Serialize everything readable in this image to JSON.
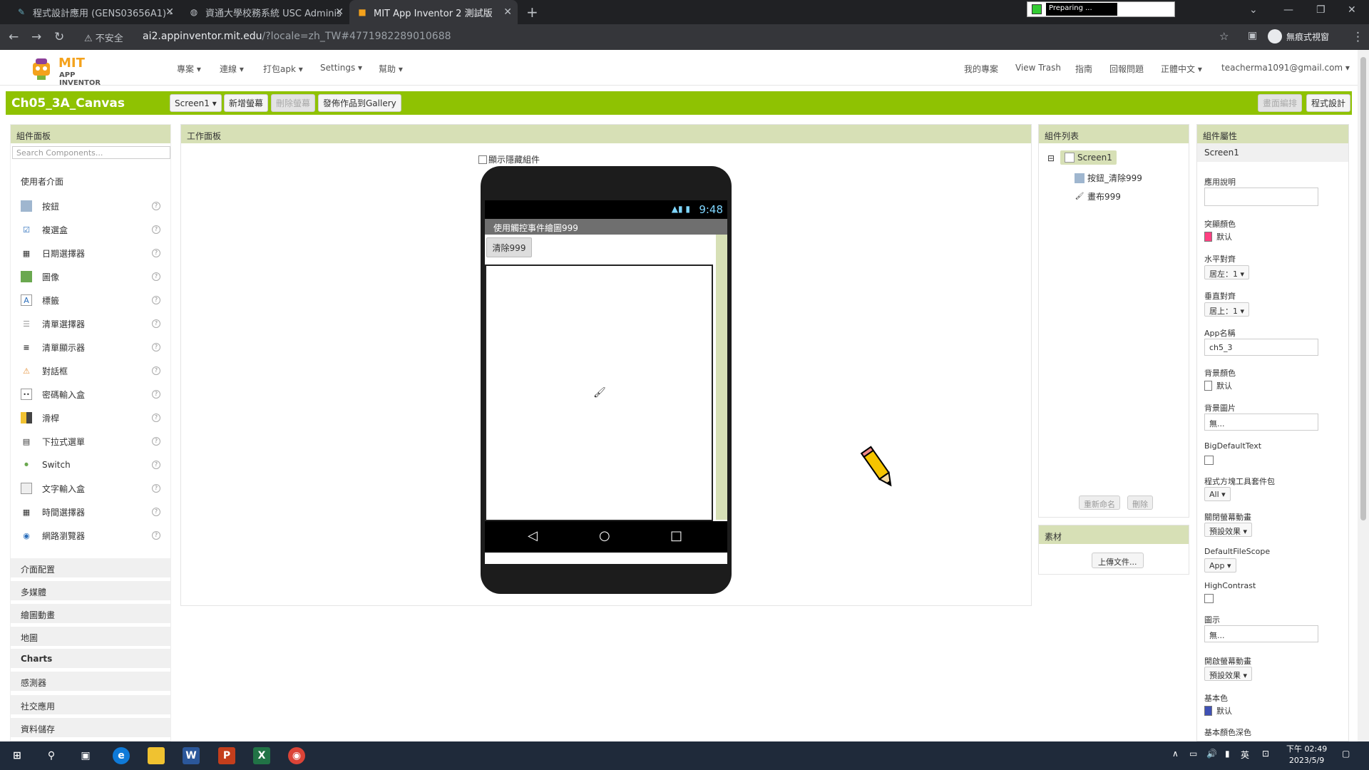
{
  "browser": {
    "tabs": [
      {
        "label": "程式設計應用 (GENS03656A1) -",
        "active": false
      },
      {
        "label": "資通大學校務系統 USC Adminis",
        "active": false
      },
      {
        "label": "MIT App Inventor 2 測試版",
        "active": true
      }
    ],
    "preparing": "Preparing ...",
    "insecure_label": "不安全",
    "url_host": "ai2.appinventor.mit.edu",
    "url_path": "/?locale=zh_TW#4771982289010688",
    "incognito_label": "無痕式視窗"
  },
  "app": {
    "logo_mit": "MIT",
    "logo_ai": "APP INVENTOR",
    "menu": [
      "專案 ▾",
      "連線 ▾",
      "打包apk ▾",
      "Settings ▾",
      "幫助 ▾"
    ],
    "right_menu": [
      "我的專案",
      "View Trash",
      "指南",
      "回報問題",
      "正體中文 ▾",
      "teacherma1091@gmail.com ▾"
    ]
  },
  "toolbar": {
    "project_title": "Ch05_3A_Canvas",
    "screen_select": "Screen1 ▾",
    "add_screen": "新增螢幕",
    "remove_screen": "刪除螢幕",
    "publish_gallery": "發佈作品到Gallery",
    "designer": "畫面編排",
    "blocks": "程式設計"
  },
  "palette": {
    "title": "組件面板",
    "search_placeholder": "Search Components...",
    "ui_category": "使用者介面",
    "components": [
      {
        "label": "按鈕",
        "icon": "button-icon"
      },
      {
        "label": "複選盒",
        "icon": "checkbox-icon"
      },
      {
        "label": "日期選擇器",
        "icon": "datepicker-icon"
      },
      {
        "label": "圖像",
        "icon": "image-icon"
      },
      {
        "label": "標籤",
        "icon": "label-icon"
      },
      {
        "label": "清單選擇器",
        "icon": "listpicker-icon"
      },
      {
        "label": "清單顯示器",
        "icon": "listview-icon"
      },
      {
        "label": "對話框",
        "icon": "notifier-icon"
      },
      {
        "label": "密碼輸入盒",
        "icon": "passwordtextbox-icon"
      },
      {
        "label": "滑桿",
        "icon": "slider-icon"
      },
      {
        "label": "下拉式選單",
        "icon": "spinner-icon"
      },
      {
        "label": "Switch",
        "icon": "switch-icon"
      },
      {
        "label": "文字輸入盒",
        "icon": "textbox-icon"
      },
      {
        "label": "時間選擇器",
        "icon": "timepicker-icon"
      },
      {
        "label": "網路瀏覽器",
        "icon": "webviewer-icon"
      }
    ],
    "help": "?",
    "categories": [
      "介面配置",
      "多媒體",
      "繪圖動畫",
      "地圖",
      "Charts",
      "感測器",
      "社交應用",
      "資料儲存"
    ]
  },
  "viewer": {
    "title": "工作面板",
    "show_hidden": "顯示隱藏組件",
    "time": "9:48",
    "screen_title": "使用觸控事件繪圖999",
    "clear_button": "清除999"
  },
  "tree": {
    "title": "組件列表",
    "collapse": "⊟",
    "root": "Screen1",
    "children": [
      "按鈕_清除999",
      "畫布999"
    ],
    "rename": "重新命名",
    "delete": "刪除"
  },
  "media": {
    "title": "素材",
    "upload": "上傳文件..."
  },
  "properties": {
    "title": "組件屬性",
    "component": "Screen1",
    "about_label": "應用說明",
    "accent_label": "突顯顏色",
    "accent_value": "默认",
    "accent_color": "#ff4081",
    "align_h_label": "水平對齊",
    "align_h_value": "居左：1 ▾",
    "align_v_label": "垂直對齊",
    "align_v_value": "居上：1 ▾",
    "appname_label": "App名稱",
    "appname_value": "ch5_3",
    "bgcolor_label": "背景顏色",
    "bgcolor_value": "默认",
    "bgimage_label": "背景圖片",
    "bgimage_value": "無...",
    "bigdefault_label": "BigDefaultText",
    "blocks_toolkit_label": "程式方塊工具套件包",
    "blocks_toolkit_value": "All ▾",
    "close_anim_label": "關閉螢幕動畫",
    "close_anim_value": "預設效果 ▾",
    "filescope_label": "DefaultFileScope",
    "filescope_value": "App ▾",
    "highcontrast_label": "HighContrast",
    "icon_label": "圖示",
    "icon_value": "無...",
    "open_anim_label": "開啟螢幕動畫",
    "open_anim_value": "預設效果 ▾",
    "primary_label": "基本色",
    "primary_value": "默认",
    "primary_color": "#3f51b5",
    "primary_dark_label": "基本顏色深色"
  },
  "taskbar": {
    "clock_time": "下午 02:49",
    "clock_date": "2023/5/9",
    "ime": "英"
  }
}
